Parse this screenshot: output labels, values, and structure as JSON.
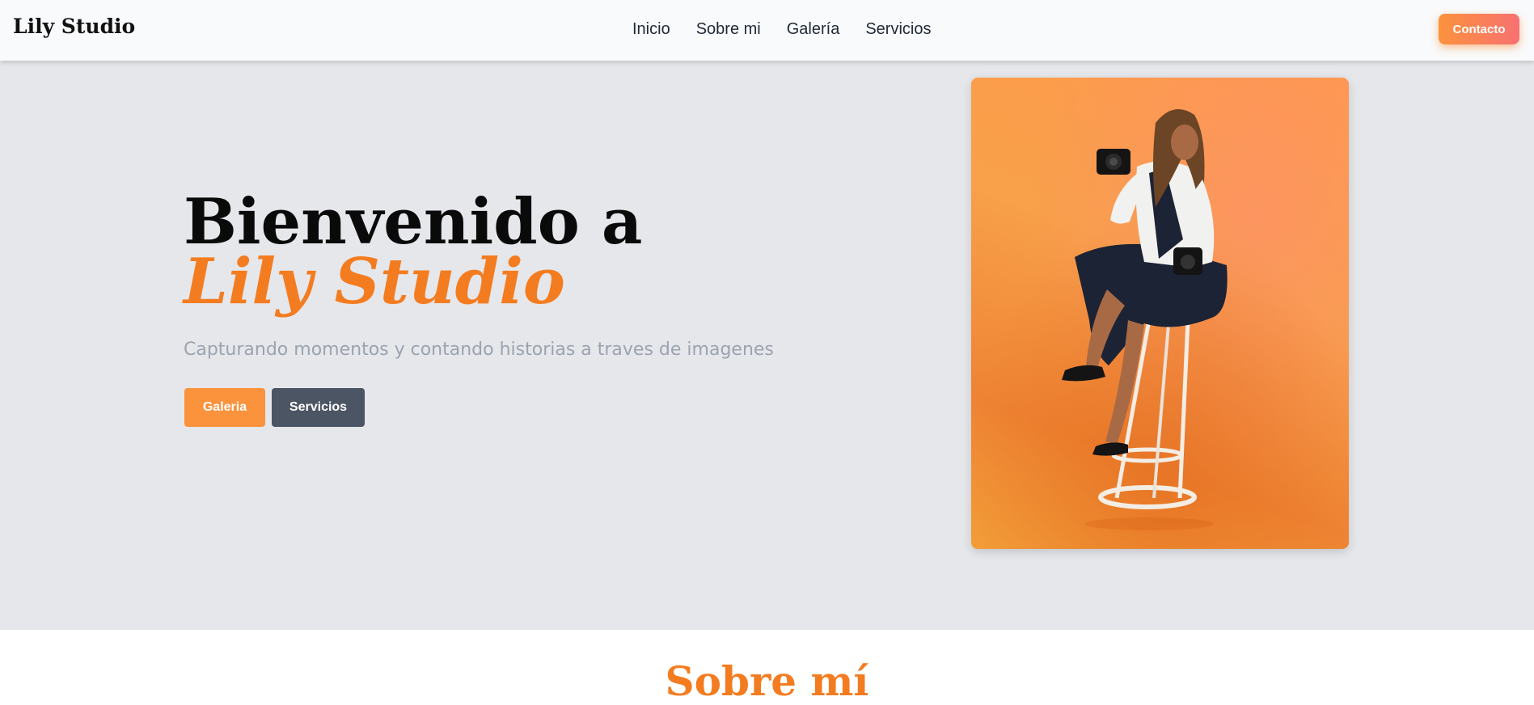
{
  "nav": {
    "brand": "Lily Studio",
    "links": [
      "Inicio",
      "Sobre mi",
      "Galería",
      "Servicios"
    ],
    "contact_label": "Contacto"
  },
  "hero": {
    "heading_line1": "Bienvenido a",
    "heading_line2": "Lily Studio",
    "subtitle": "Capturando momentos y contando historias a traves de imagenes",
    "primary_button": "Galeria",
    "secondary_button": "Servicios"
  },
  "about": {
    "title": "Sobre mí"
  },
  "colors": {
    "accent": "#f47c20",
    "nav_bg": "#f9fafb",
    "hero_bg": "#e5e7eb",
    "primary_button": "#fb923c",
    "secondary_button": "#4b5563",
    "subtitle": "#9ca3af"
  }
}
